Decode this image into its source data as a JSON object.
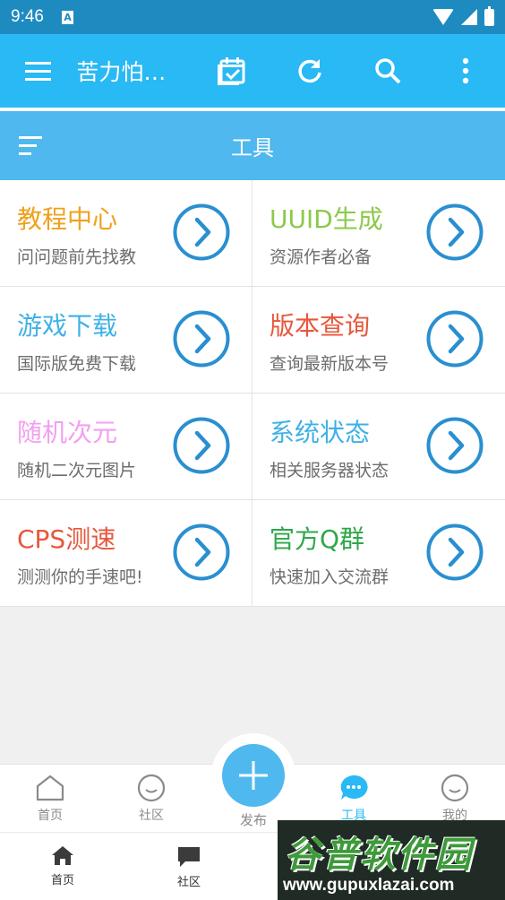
{
  "status_bar": {
    "time": "9:46",
    "notification": "A"
  },
  "app_bar": {
    "title": "苦力怕…"
  },
  "section": {
    "title": "工具"
  },
  "tools": [
    {
      "title": "教程中心",
      "subtitle": "问问题前先找教",
      "color": "#f0a11b"
    },
    {
      "title": "UUID生成",
      "subtitle": "资源作者必备",
      "color": "#8cc94a"
    },
    {
      "title": "游戏下载",
      "subtitle": "国际版免费下载",
      "color": "#3fb1e6"
    },
    {
      "title": "版本查询",
      "subtitle": "查询最新版本号",
      "color": "#e7573d"
    },
    {
      "title": "随机次元",
      "subtitle": "随机二次元图片",
      "color": "#f39ef0"
    },
    {
      "title": "系统状态",
      "subtitle": "相关服务器状态",
      "color": "#3fb1e6"
    },
    {
      "title": "CPS测速",
      "subtitle": "测测你的手速吧!",
      "color": "#e7573d"
    },
    {
      "title": "官方Q群",
      "subtitle": "快速加入交流群",
      "color": "#2ea84a"
    }
  ],
  "bottom_nav": {
    "home": "首页",
    "community": "社区",
    "publish": "发布",
    "tools": "工具",
    "mine": "我的"
  },
  "secondary_nav": {
    "home": "首页",
    "community": "社区"
  },
  "watermark": {
    "name": "谷普软件园",
    "url": "www.gupuxlazai.com"
  },
  "colors": {
    "primary": "#29b9f4",
    "status_bar": "#1e8bc0",
    "arrow": "#2a8fd0"
  }
}
